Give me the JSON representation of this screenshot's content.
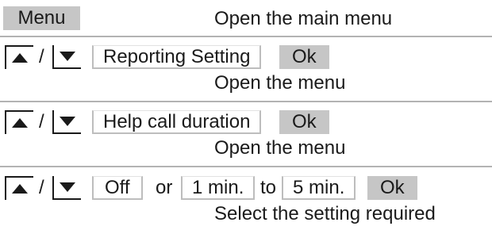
{
  "row1": {
    "button": "Menu",
    "description": "Open the main menu"
  },
  "row2": {
    "separator": "/",
    "display": "Reporting Setting",
    "ok": "Ok",
    "description": "Open the menu"
  },
  "row3": {
    "separator": "/",
    "display": "Help call duration",
    "ok": "Ok",
    "description": "Open the menu"
  },
  "row4": {
    "separator": "/",
    "option_off": "Off",
    "word_or": "or",
    "option_min": "1 min.",
    "word_to": "to",
    "option_max": "5 min.",
    "ok": "Ok",
    "description": "Select the setting required"
  },
  "icons": {
    "up": "arrow-up-key-icon",
    "down": "arrow-down-key-icon"
  },
  "colors": {
    "softkey": "#c6c6c6",
    "separator": "#b3b3b3",
    "text": "#1a1a1a"
  }
}
